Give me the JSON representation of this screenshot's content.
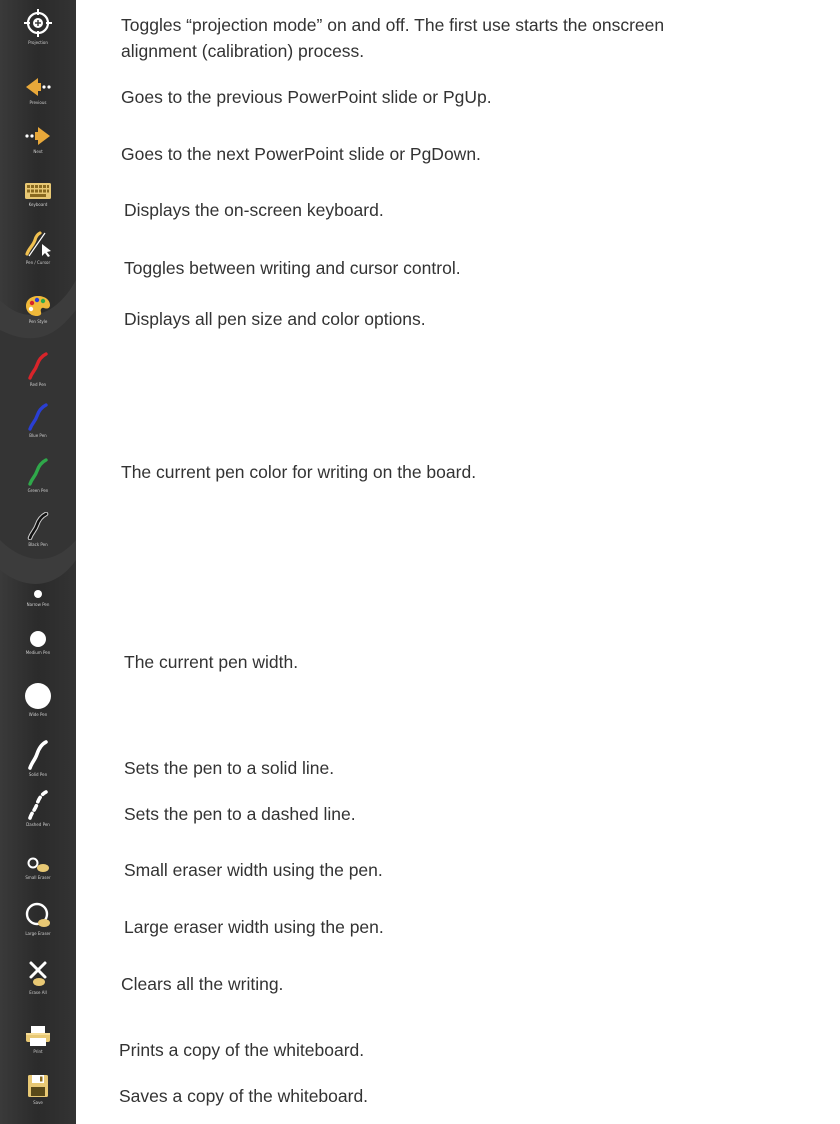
{
  "toolbar": {
    "items": [
      {
        "label": "Projection",
        "icon": "projection-crosshair-icon"
      },
      {
        "label": "Previous",
        "icon": "previous-arrow-icon"
      },
      {
        "label": "Next",
        "icon": "next-arrow-icon"
      },
      {
        "label": "Keyboard",
        "icon": "keyboard-icon"
      },
      {
        "label": "Pen / Cursor",
        "icon": "pen-cursor-toggle-icon"
      },
      {
        "label": "Pen Style",
        "icon": "palette-icon"
      },
      {
        "label": "Red Pen",
        "icon": "red-pen-icon",
        "color": "#d8242a"
      },
      {
        "label": "Blue Pen",
        "icon": "blue-pen-icon",
        "color": "#2a3fd4"
      },
      {
        "label": "Green Pen",
        "icon": "green-pen-icon",
        "color": "#2fa84a"
      },
      {
        "label": "Black Pen",
        "icon": "black-pen-icon",
        "color": "#111111"
      },
      {
        "label": "Narrow Pen",
        "icon": "narrow-width-icon"
      },
      {
        "label": "Medium Pen",
        "icon": "medium-width-icon"
      },
      {
        "label": "Wide Pen",
        "icon": "wide-width-icon"
      },
      {
        "label": "Solid Pen",
        "icon": "solid-line-icon"
      },
      {
        "label": "Dashed Pen",
        "icon": "dashed-line-icon"
      },
      {
        "label": "Small Eraser",
        "icon": "small-eraser-icon"
      },
      {
        "label": "Large Eraser",
        "icon": "large-eraser-icon"
      },
      {
        "label": "Erase All",
        "icon": "erase-all-icon"
      },
      {
        "label": "Print",
        "icon": "printer-icon"
      },
      {
        "label": "Save",
        "icon": "save-disk-icon"
      }
    ]
  },
  "descriptions": {
    "projection": "Toggles “projection mode” on and off. The first use starts the onscreen",
    "projection_2": "alignment (calibration) process.",
    "previous": "Goes to the previous PowerPoint slide or PgUp.",
    "next": "Goes to the next PowerPoint slide or PgDown.",
    "keyboard": "Displays the on-screen keyboard.",
    "pen_cursor": "Toggles between writing and cursor control.",
    "pen_style": "Displays all pen size and color options.",
    "pen_color": "The current pen color for writing on the board.",
    "pen_width": "The current pen width.",
    "solid": "Sets the pen to a solid line.",
    "dashed": "Sets the pen to a dashed line.",
    "small_eraser": "Small eraser width using the pen.",
    "large_eraser": "Large eraser width using the pen.",
    "erase_all": "Clears all the writing.",
    "print": "Prints a copy of the whiteboard.",
    "save": "Saves a copy of the whiteboard."
  },
  "colors": {
    "toolbar_bg": "#2e2e2e",
    "toolbar_bg_light": "#444444",
    "icon": "#ffffff",
    "accent_orange": "#e8a83a",
    "text": "#333333"
  }
}
